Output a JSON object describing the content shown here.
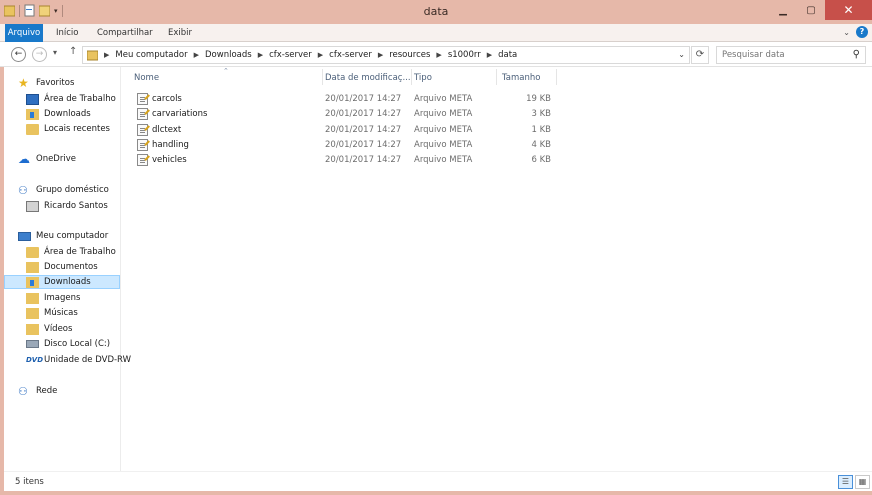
{
  "window": {
    "title": "data"
  },
  "ribbon": {
    "tabs": [
      "Arquivo",
      "Início",
      "Compartilhar",
      "Exibir"
    ]
  },
  "address": {
    "breadcrumbs": [
      "Meu computador",
      "Downloads",
      "cfx-server",
      "cfx-server",
      "resources",
      "s1000rr",
      "data"
    ]
  },
  "search": {
    "placeholder": "Pesquisar data"
  },
  "nav": {
    "favorites": {
      "label": "Favoritos",
      "items": [
        "Área de Trabalho",
        "Downloads",
        "Locais recentes"
      ]
    },
    "onedrive": {
      "label": "OneDrive"
    },
    "homegroup": {
      "label": "Grupo doméstico",
      "items": [
        "Ricardo Santos"
      ]
    },
    "computer": {
      "label": "Meu computador",
      "items": [
        "Área de Trabalho",
        "Documentos",
        "Downloads",
        "Imagens",
        "Músicas",
        "Vídeos",
        "Disco Local (C:)",
        "Unidade de DVD-RW"
      ]
    },
    "network": {
      "label": "Rede"
    }
  },
  "columns": {
    "name": "Nome",
    "date": "Data de modificaç...",
    "type": "Tipo",
    "size": "Tamanho"
  },
  "files": [
    {
      "name": "carcols",
      "date": "20/01/2017 14:27",
      "type": "Arquivo META",
      "size": "19 KB"
    },
    {
      "name": "carvariations",
      "date": "20/01/2017 14:27",
      "type": "Arquivo META",
      "size": "3 KB"
    },
    {
      "name": "dlctext",
      "date": "20/01/2017 14:27",
      "type": "Arquivo META",
      "size": "1 KB"
    },
    {
      "name": "handling",
      "date": "20/01/2017 14:27",
      "type": "Arquivo META",
      "size": "4 KB"
    },
    {
      "name": "vehicles",
      "date": "20/01/2017 14:27",
      "type": "Arquivo META",
      "size": "6 KB"
    }
  ],
  "status": {
    "count": "5 itens"
  },
  "colors": {
    "accent": "#1979ca",
    "frame": "#e6b8a9",
    "selection": "#cce8ff",
    "close": "#c7504a"
  }
}
